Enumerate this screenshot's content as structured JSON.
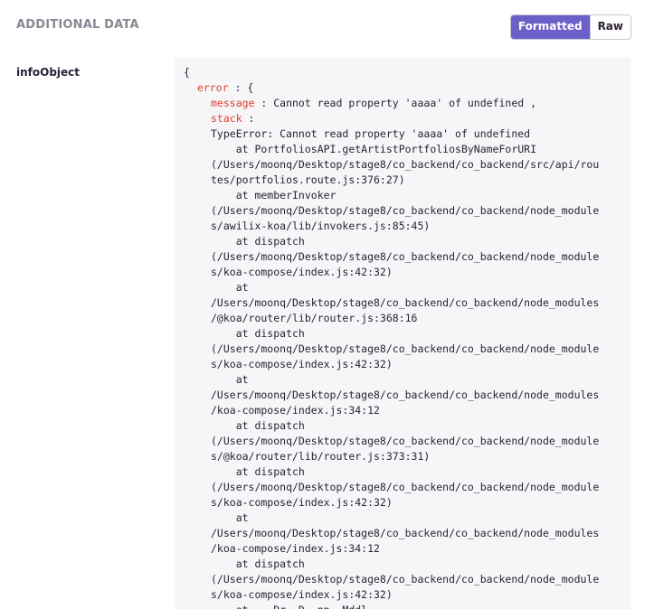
{
  "section": {
    "title": "ADDITIONAL DATA"
  },
  "toggle": {
    "formatted_label": "Formatted",
    "raw_label": "Raw",
    "active": "Formatted"
  },
  "entry": {
    "key": "infoObject",
    "open_brace": "{",
    "error_key": "error",
    "error_sep": " : {",
    "message_key": "message",
    "message_value": " : Cannot read property 'aaaa' of undefined ,",
    "stack_key": "stack",
    "stack_sep": " :",
    "stack_lines": [
      "TypeError: Cannot read property 'aaaa' of undefined",
      "    at PortfoliosAPI.getArtistPortfoliosByNameForURI",
      "(/Users/moonq/Desktop/stage8/co_backend/co_backend/src/api/rou",
      "tes/portfolios.route.js:376:27)",
      "    at memberInvoker",
      "(/Users/moonq/Desktop/stage8/co_backend/co_backend/node_module",
      "s/awilix-koa/lib/invokers.js:85:45)",
      "    at dispatch",
      "(/Users/moonq/Desktop/stage8/co_backend/co_backend/node_module",
      "s/koa-compose/index.js:42:32)",
      "    at",
      "/Users/moonq/Desktop/stage8/co_backend/co_backend/node_modules",
      "/@koa/router/lib/router.js:368:16",
      "    at dispatch",
      "(/Users/moonq/Desktop/stage8/co_backend/co_backend/node_module",
      "s/koa-compose/index.js:42:32)",
      "    at",
      "/Users/moonq/Desktop/stage8/co_backend/co_backend/node_modules",
      "/koa-compose/index.js:34:12",
      "    at dispatch",
      "(/Users/moonq/Desktop/stage8/co_backend/co_backend/node_module",
      "s/@koa/router/lib/router.js:373:31)",
      "    at dispatch",
      "(/Users/moonq/Desktop/stage8/co_backend/co_backend/node_module",
      "s/koa-compose/index.js:42:32)",
      "    at",
      "/Users/moonq/Desktop/stage8/co_backend/co_backend/node_modules",
      "/koa-compose/index.js:34:12",
      "    at dispatch",
      "(/Users/moonq/Desktop/stage8/co_backend/co_backend/node_module",
      "s/koa-compose/index.js:42:32)",
      "    at    Dr  D  nn  Mddl  "
    ]
  },
  "colors": {
    "accent": "#6c5fc7",
    "key_red": "#e03e2f",
    "muted_heading": "#8a8792",
    "code_bg": "#f6f6f8"
  }
}
